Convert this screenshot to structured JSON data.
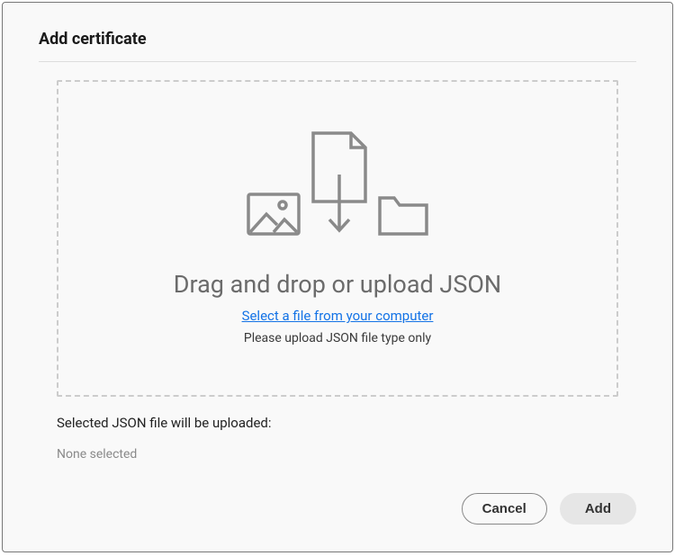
{
  "dialog": {
    "title": "Add certificate",
    "dropzone": {
      "heading": "Drag and drop or upload JSON",
      "select_link": "Select a file from your computer",
      "file_hint": "Please upload JSON file type only"
    },
    "selected": {
      "label": "Selected JSON file will be uploaded:",
      "value": "None selected"
    },
    "buttons": {
      "cancel": "Cancel",
      "add": "Add"
    }
  }
}
